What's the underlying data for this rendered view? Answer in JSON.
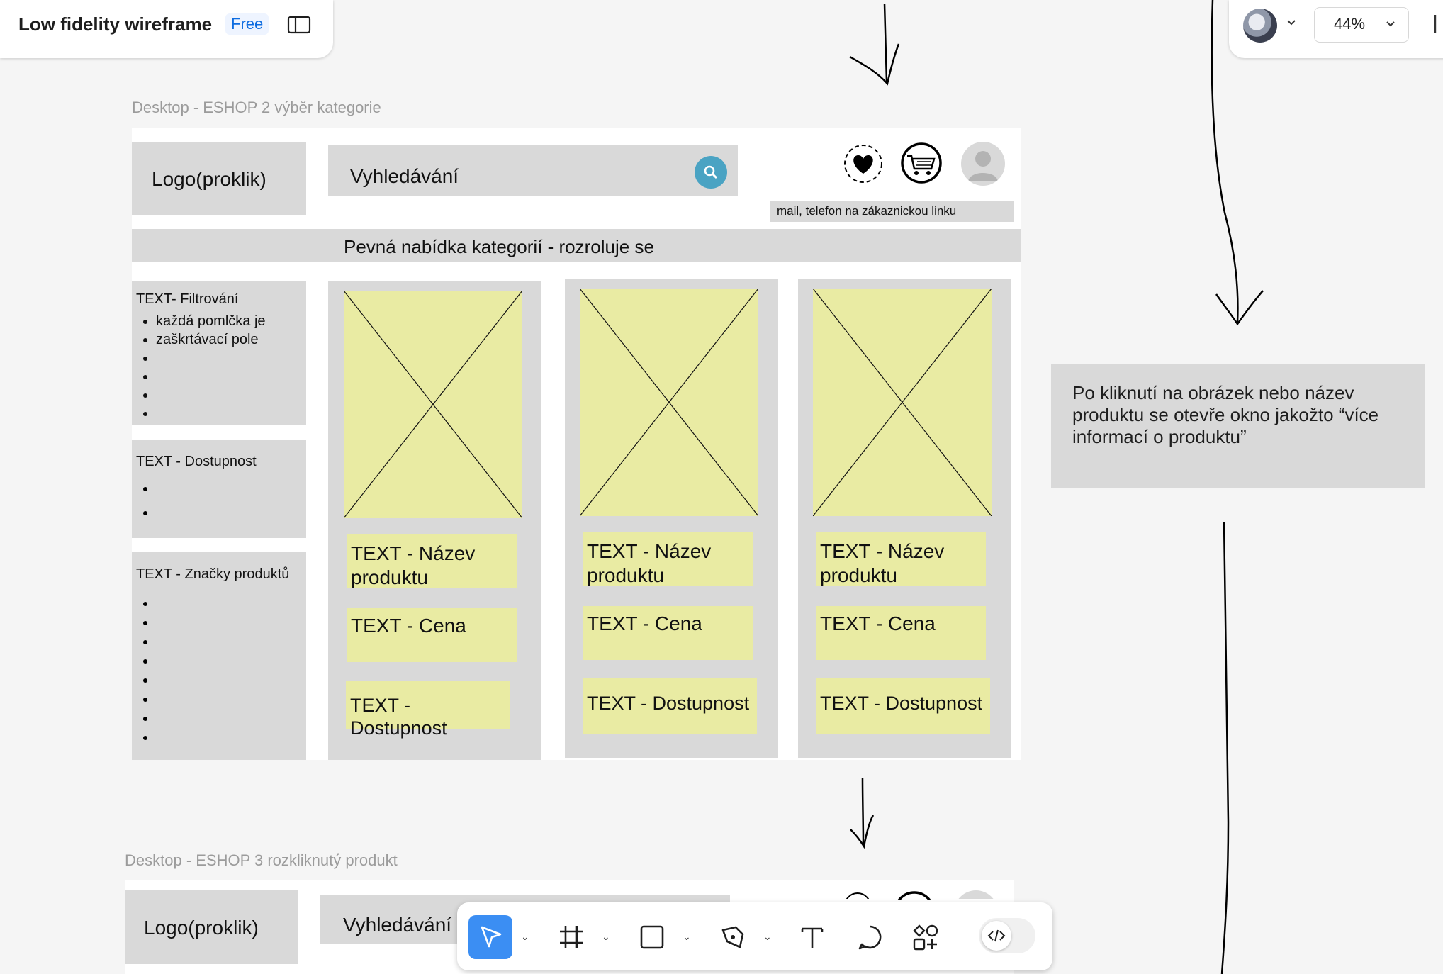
{
  "app": {
    "file_title": "Low fidelity wireframe",
    "plan_badge": "Free",
    "zoom": "44%"
  },
  "frame1": {
    "label": "Desktop - ESHOP  2 výběr kategorie",
    "logo": "Logo(proklik)",
    "search_placeholder": "Vyhledávání",
    "contact": "mail, telefon na zákaznickou linku",
    "category_bar": "Pevná nabídka kategorií - rozroluje se",
    "filters": {
      "filter_title": "TEXT- Filtrování",
      "filter_items": [
        "každá pomlčka je",
        "zaškrtávací pole",
        "",
        "",
        "",
        ""
      ],
      "availability_title": "TEXT - Dostupnost",
      "brands_title": "TEXT - Značky produktů"
    },
    "products": [
      {
        "name": "TEXT - Název produktu",
        "price": "TEXT - Cena",
        "availability": "TEXT - Dostupnost"
      },
      {
        "name": "TEXT - Název produktu",
        "price": "TEXT - Cena",
        "availability": "TEXT - Dostupnost"
      },
      {
        "name": "TEXT - Název produktu",
        "price": "TEXT - Cena",
        "availability": "TEXT - Dostupnost"
      }
    ]
  },
  "note": {
    "text": "Po kliknutí na obrázek nebo název produktu se otevře okno jakožto “více informací o produktu”"
  },
  "frame2": {
    "label": "Desktop - ESHOP 3 rozkliknutý produkt",
    "logo": "Logo(proklik)",
    "search_placeholder": "Vyhledávání"
  },
  "toolbar": {
    "tools": [
      "move-tool",
      "frame-tool",
      "rectangle-tool",
      "pen-tool",
      "text-tool",
      "comment-tool",
      "actions-tool",
      "dev-mode-toggle"
    ]
  },
  "colors": {
    "accent": "#3b8ef3",
    "wire_grey": "#d9d9d9",
    "wire_yellow": "#e9eba3",
    "search_button": "#4aa3c3"
  }
}
